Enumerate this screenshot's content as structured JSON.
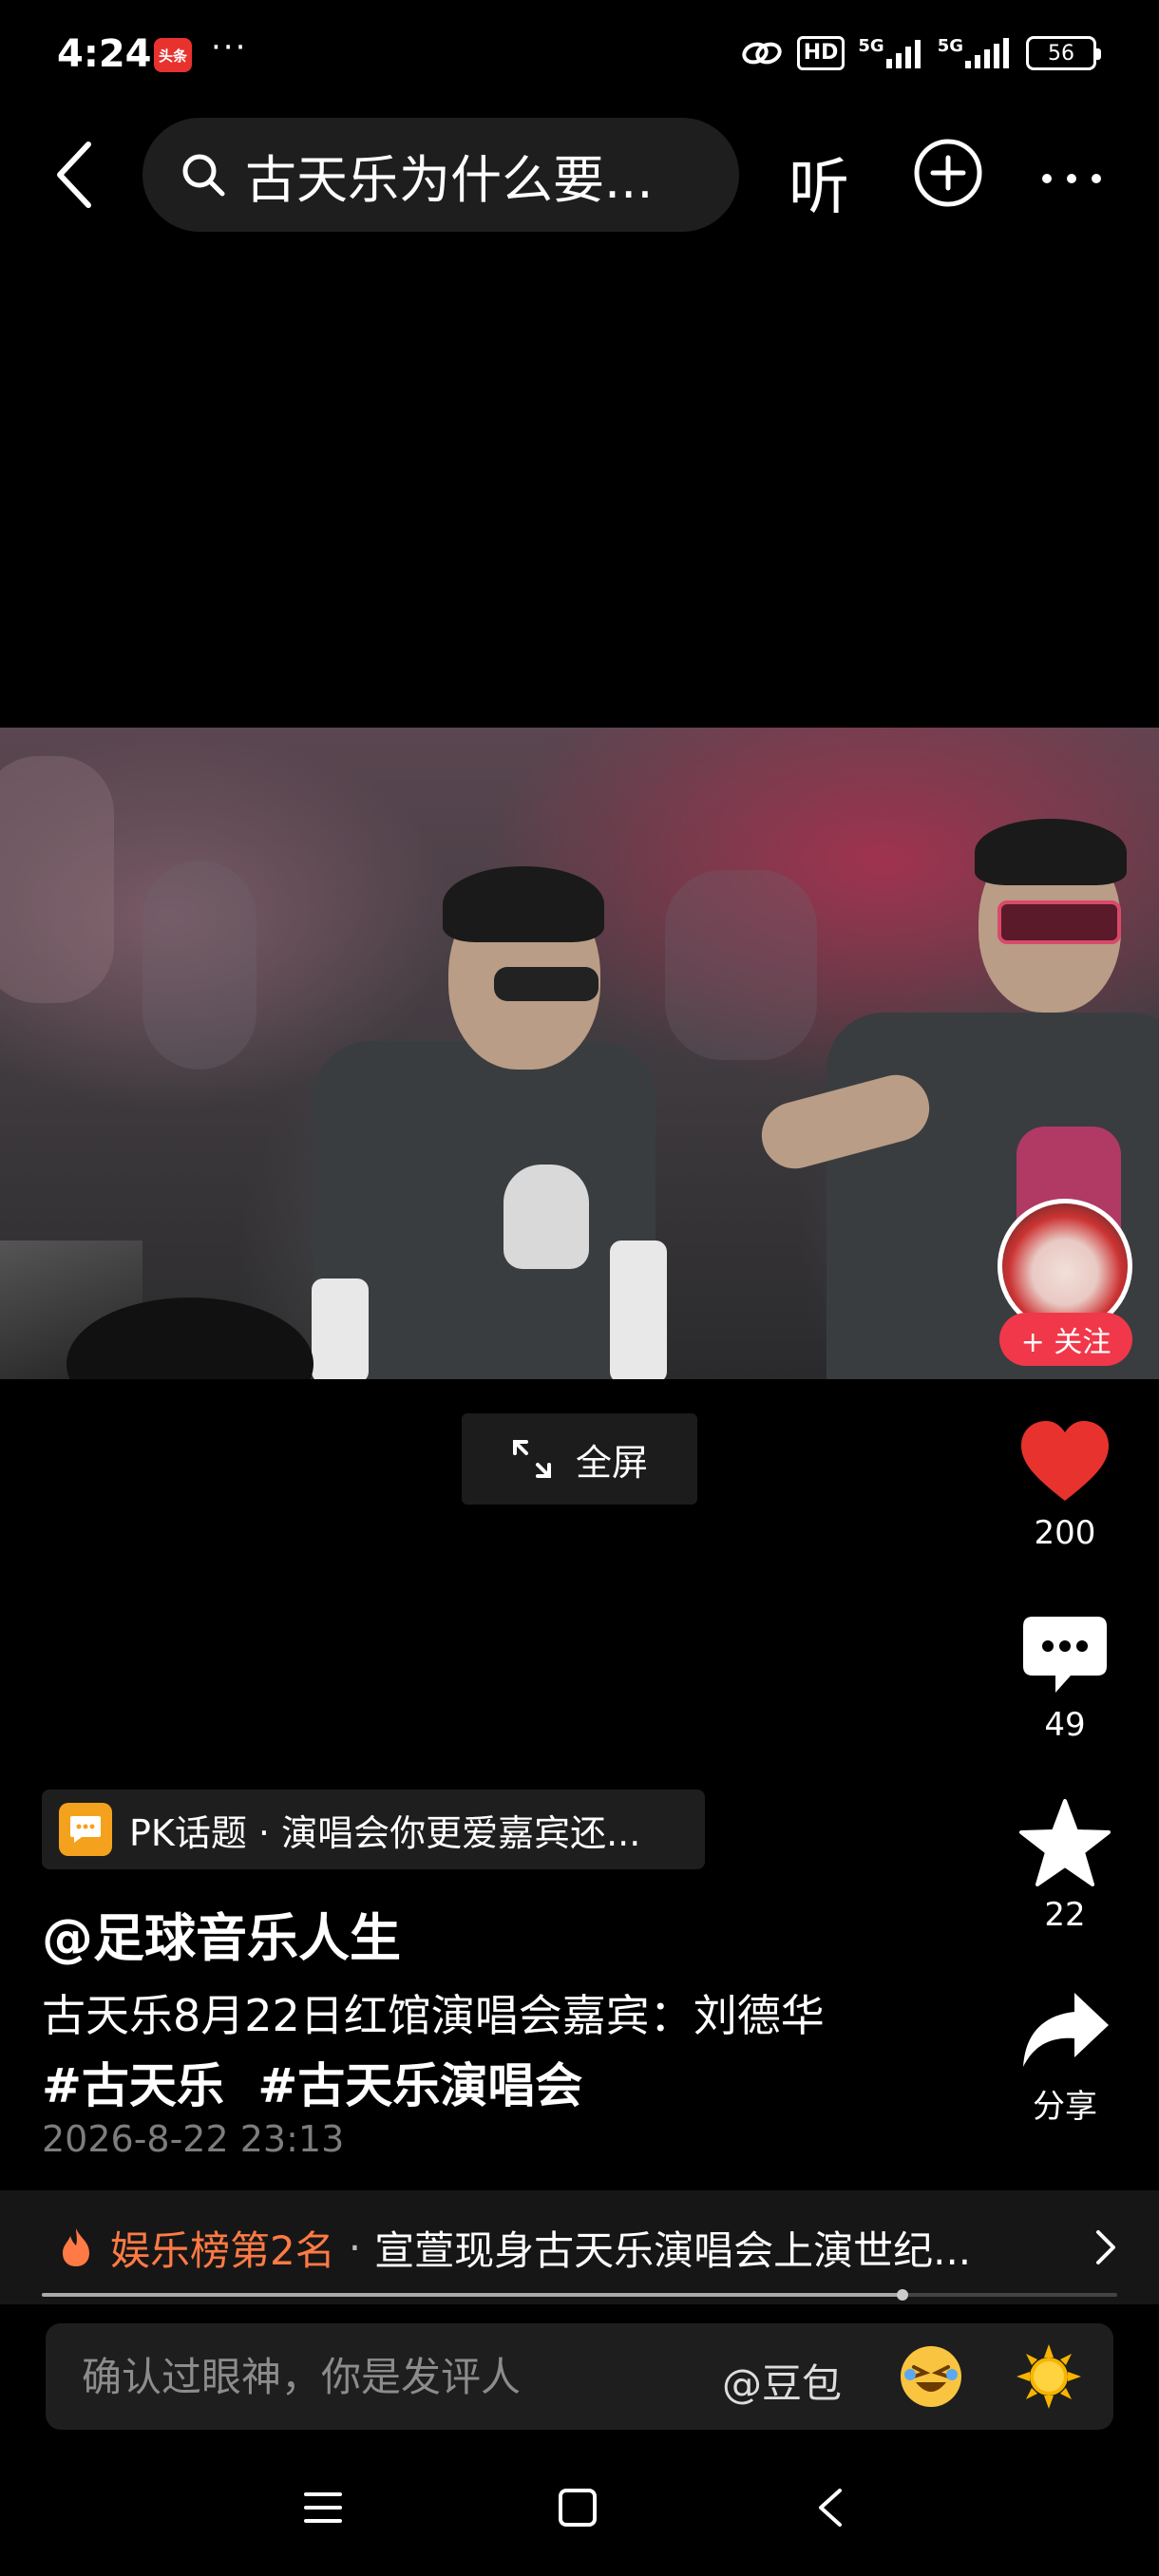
{
  "status_bar": {
    "time": "4:24",
    "app_badge": "头条",
    "more": "···",
    "network": "HD",
    "signal_1": "5G",
    "signal_2": "5G",
    "battery": "56"
  },
  "top_nav": {
    "search_query": "古天乐为什么要...",
    "listen_label": "听"
  },
  "video": {
    "follow_label": "+ 关注",
    "fullscreen_label": "全屏"
  },
  "actions": {
    "likes": "200",
    "comments": "49",
    "favorites": "22",
    "share_label": "分享"
  },
  "post": {
    "pk_topic": "PK话题 · 演唱会你更爱嘉宾还...",
    "author": "@足球音乐人生",
    "description": "古天乐8月22日红馆演唱会嘉宾：刘德华",
    "hashtags": [
      "#古天乐",
      "#古天乐演唱会"
    ],
    "date": "2026-8-22 23:13"
  },
  "ranking": {
    "label": "娱乐榜第2名",
    "separator": "·",
    "title": "宣萱现身古天乐演唱会上演世纪..."
  },
  "comment_bar": {
    "placeholder": "确认过眼神，你是发评人",
    "at_label": "@豆包"
  },
  "colors": {
    "accent_red": "#f0384a",
    "like_red": "#e8322e",
    "rank_orange": "#ff7a45",
    "pk_yellow": "#f4a21d"
  },
  "progress_fraction": 0.8
}
